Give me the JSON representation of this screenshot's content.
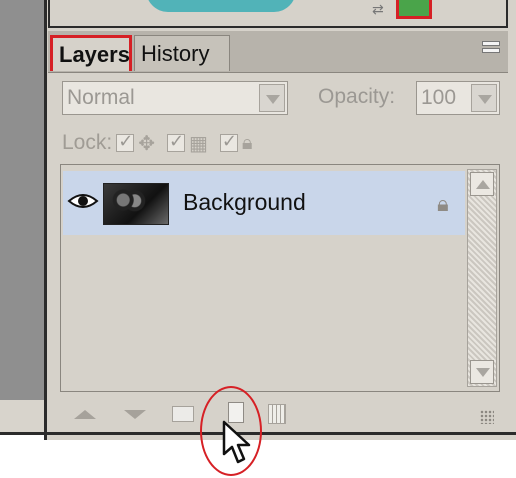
{
  "tabs": [
    {
      "label": "Layers",
      "active": true
    },
    {
      "label": "History",
      "active": false
    }
  ],
  "blend_mode": {
    "value": "Normal"
  },
  "opacity": {
    "label": "Opacity:",
    "value": "100"
  },
  "lock": {
    "label": "Lock:"
  },
  "layers": [
    {
      "name": "Background",
      "visible": true,
      "locked": true,
      "selected": true
    }
  ],
  "colors": {
    "highlight_red": "#d62025",
    "selected_row": "#c9d6ea",
    "panel_bg": "#d6d2ca",
    "teal": "#39aeb5",
    "green": "#4aa44a"
  },
  "icons": {
    "visibility": "eye-icon",
    "lock": "lock-icon",
    "move_up": "arrow-up-icon",
    "move_down": "arrow-down-icon",
    "new_group": "folder-icon",
    "new_layer": "new-layer-icon",
    "delete": "trash-icon",
    "cursor": "mouse-pointer-icon"
  }
}
